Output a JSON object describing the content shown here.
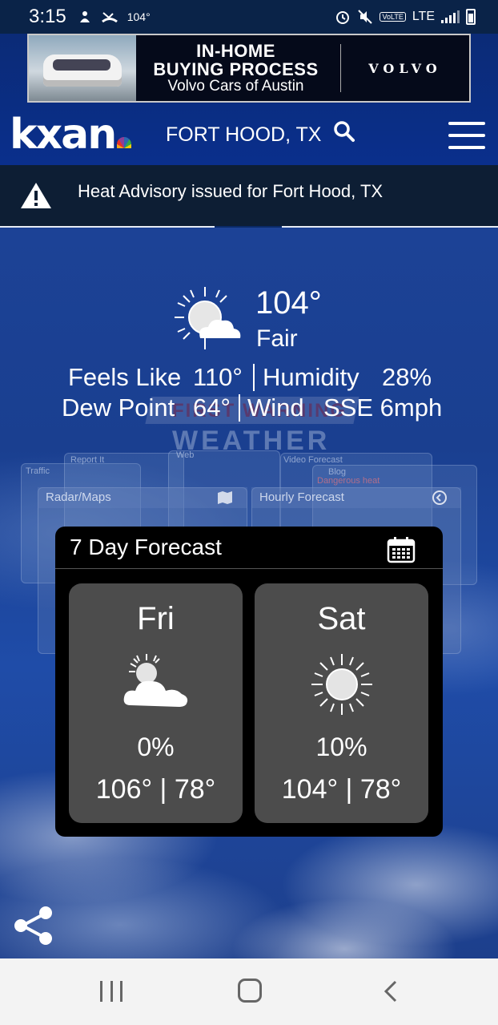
{
  "status_bar": {
    "time": "3:15",
    "temp_badge": "104°",
    "network": "LTE",
    "volte": "VoLTE"
  },
  "ad": {
    "line1": "IN-HOME",
    "line2": "BUYING PROCESS",
    "line3": "Volvo Cars of Austin",
    "brand": "VOLVO"
  },
  "header": {
    "logo": "kxan",
    "location": "FORT HOOD, TX"
  },
  "alert": {
    "text": "Heat Advisory issued for Fort Hood, TX"
  },
  "current": {
    "temperature": "104°",
    "condition": "Fair",
    "feels_like_label": "Feels Like",
    "feels_like_value": "110°",
    "humidity_label": "Humidity",
    "humidity_value": "28%",
    "dew_point_label": "Dew Point",
    "dew_point_value": "64°",
    "wind_label": "Wind",
    "wind_value": "SSE 6mph"
  },
  "background_widgets": {
    "brand_top": "FIRST WARNING",
    "brand_bottom": "WEATHER",
    "labels": [
      "Traffic",
      "Report It",
      "Web",
      "Video Forecast",
      "Blog",
      "Dangerous heat"
    ],
    "tab_radar": "Radar/Maps",
    "tab_hourly": "Hourly Forecast"
  },
  "forecast": {
    "title": "7 Day Forecast",
    "days": [
      {
        "name": "Fri",
        "icon": "partly-cloudy",
        "precip": "0%",
        "temps": "106° | 78°"
      },
      {
        "name": "Sat",
        "icon": "sunny",
        "precip": "10%",
        "temps": "104° | 78°"
      }
    ]
  },
  "icons": {
    "search": "search-icon",
    "menu": "menu-icon",
    "alert": "warning-icon",
    "calendar": "calendar-icon",
    "share": "share-icon"
  }
}
